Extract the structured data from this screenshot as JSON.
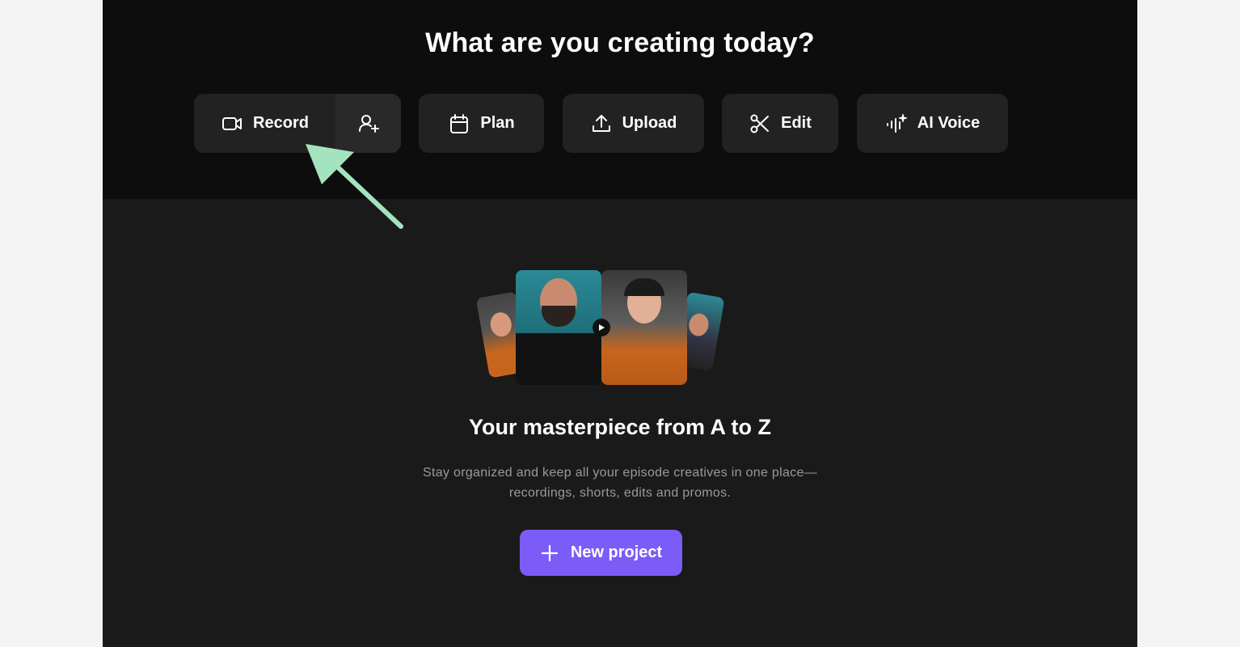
{
  "header": {
    "title": "What are you creating today?"
  },
  "actions": {
    "record": {
      "label": "Record",
      "icon": "video-camera-icon",
      "invite_icon": "add-person-icon"
    },
    "plan": {
      "label": "Plan",
      "icon": "calendar-icon"
    },
    "upload": {
      "label": "Upload",
      "icon": "upload-icon"
    },
    "edit": {
      "label": "Edit",
      "icon": "scissors-icon"
    },
    "ai_voice": {
      "label": "AI Voice",
      "icon": "ai-voice-waveform-icon"
    }
  },
  "empty_state": {
    "title": "Your masterpiece from A to Z",
    "description_line1": "Stay organized and keep all your episode creatives in one place—",
    "description_line2": "recordings, shorts, edits and promos.",
    "cta_label": "New project",
    "cta_icon": "plus-icon"
  },
  "colors": {
    "accent": "#7c5cf7",
    "annotation_arrow": "#a3e4bf",
    "background": "#1a1a1a",
    "top_band": "#0d0d0d",
    "button_bg": "#222222"
  }
}
